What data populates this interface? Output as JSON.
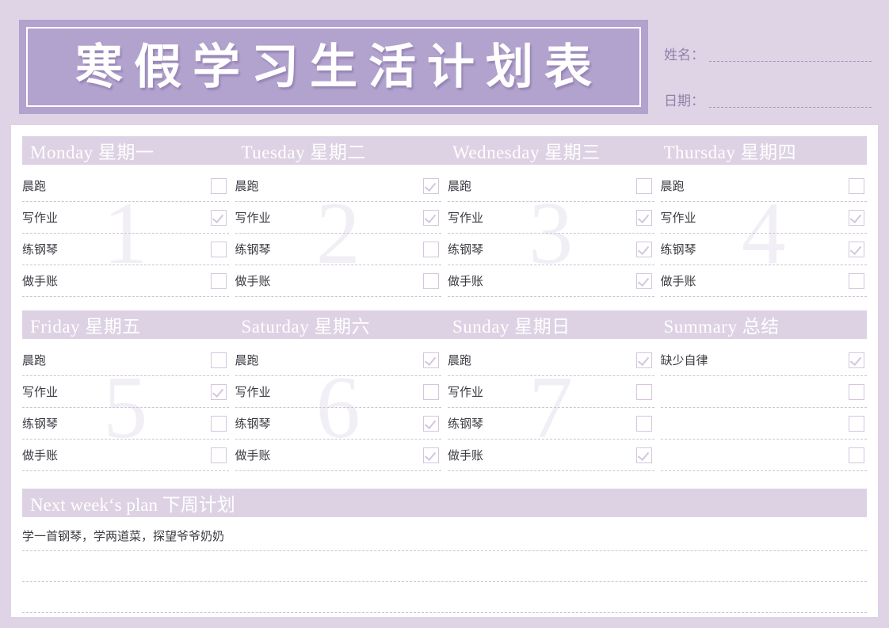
{
  "title": "寒假学习生活计划表",
  "meta": {
    "name_label": "姓名：",
    "name_value": "",
    "date_label": "日期：",
    "date_value": ""
  },
  "colors": {
    "page_bg": "#ded4e6",
    "banner": "#b2a2ce",
    "day_header": "#ddd2e4",
    "card": "#ffffff",
    "text": "#3a3a42",
    "checkbox_border": "#d5c6dd",
    "watermark": "#f1eff5"
  },
  "weeks": [
    {
      "days": [
        {
          "header": "Monday  星期一",
          "watermark": "1",
          "tasks": [
            {
              "label": "晨跑",
              "checked": false
            },
            {
              "label": "写作业",
              "checked": true
            },
            {
              "label": "练钢琴",
              "checked": false
            },
            {
              "label": "做手账",
              "checked": false
            }
          ]
        },
        {
          "header": "Tuesday  星期二",
          "watermark": "2",
          "tasks": [
            {
              "label": "晨跑",
              "checked": true
            },
            {
              "label": "写作业",
              "checked": true
            },
            {
              "label": "练钢琴",
              "checked": false
            },
            {
              "label": "做手账",
              "checked": false
            }
          ]
        },
        {
          "header": "Wednesday  星期三",
          "watermark": "3",
          "tasks": [
            {
              "label": "晨跑",
              "checked": false
            },
            {
              "label": "写作业",
              "checked": true
            },
            {
              "label": "练钢琴",
              "checked": true
            },
            {
              "label": "做手账",
              "checked": true
            }
          ]
        },
        {
          "header": "Thursday  星期四",
          "watermark": "4",
          "tasks": [
            {
              "label": "晨跑",
              "checked": false
            },
            {
              "label": "写作业",
              "checked": true
            },
            {
              "label": "练钢琴",
              "checked": true
            },
            {
              "label": "做手账",
              "checked": false
            }
          ]
        }
      ]
    },
    {
      "days": [
        {
          "header": "Friday  星期五",
          "watermark": "5",
          "tasks": [
            {
              "label": "晨跑",
              "checked": false
            },
            {
              "label": "写作业",
              "checked": true
            },
            {
              "label": "练钢琴",
              "checked": false
            },
            {
              "label": "做手账",
              "checked": false
            }
          ]
        },
        {
          "header": "Saturday  星期六",
          "watermark": "6",
          "tasks": [
            {
              "label": "晨跑",
              "checked": true
            },
            {
              "label": "写作业",
              "checked": false
            },
            {
              "label": "练钢琴",
              "checked": true
            },
            {
              "label": "做手账",
              "checked": true
            }
          ]
        },
        {
          "header": "Sunday  星期日",
          "watermark": "7",
          "tasks": [
            {
              "label": "晨跑",
              "checked": true
            },
            {
              "label": "写作业",
              "checked": false
            },
            {
              "label": "练钢琴",
              "checked": false
            },
            {
              "label": "做手账",
              "checked": true
            }
          ]
        },
        {
          "header": "Summary  总结",
          "watermark": "",
          "tasks": [
            {
              "label": "缺少自律",
              "checked": true
            },
            {
              "label": "",
              "checked": false
            },
            {
              "label": "",
              "checked": false
            },
            {
              "label": "",
              "checked": false
            }
          ]
        }
      ]
    }
  ],
  "plan": {
    "header": "Next week‘s plan  下周计划",
    "lines": [
      "学一首钢琴，学两道菜，探望爷爷奶奶",
      "",
      ""
    ]
  }
}
